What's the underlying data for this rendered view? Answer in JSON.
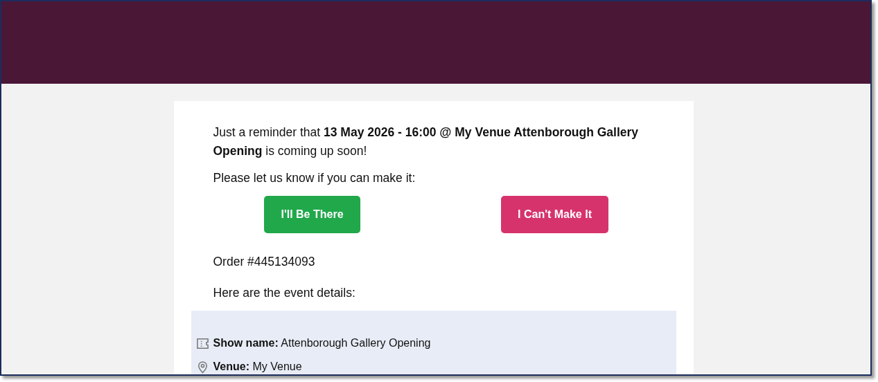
{
  "reminder": "Just a reminder that **13 May 2026 - 16:00 @ My Venue Attenborough Gallery Opening** is coming up soon!",
  "prompt": "Please let us know if you can make it:",
  "buttons": [
    {
      "label": "I'll Be There",
      "kind": "accept"
    },
    {
      "label": "I Can't Make It",
      "kind": "decline"
    }
  ],
  "order": "Order #445134093",
  "details_intro": "Here are the event details:",
  "details": [
    {
      "kind": "ticket",
      "label": "Show name:",
      "value": "Attenborough Gallery Opening"
    },
    {
      "kind": "venue",
      "label": "Venue:",
      "value": "My Venue"
    }
  ]
}
